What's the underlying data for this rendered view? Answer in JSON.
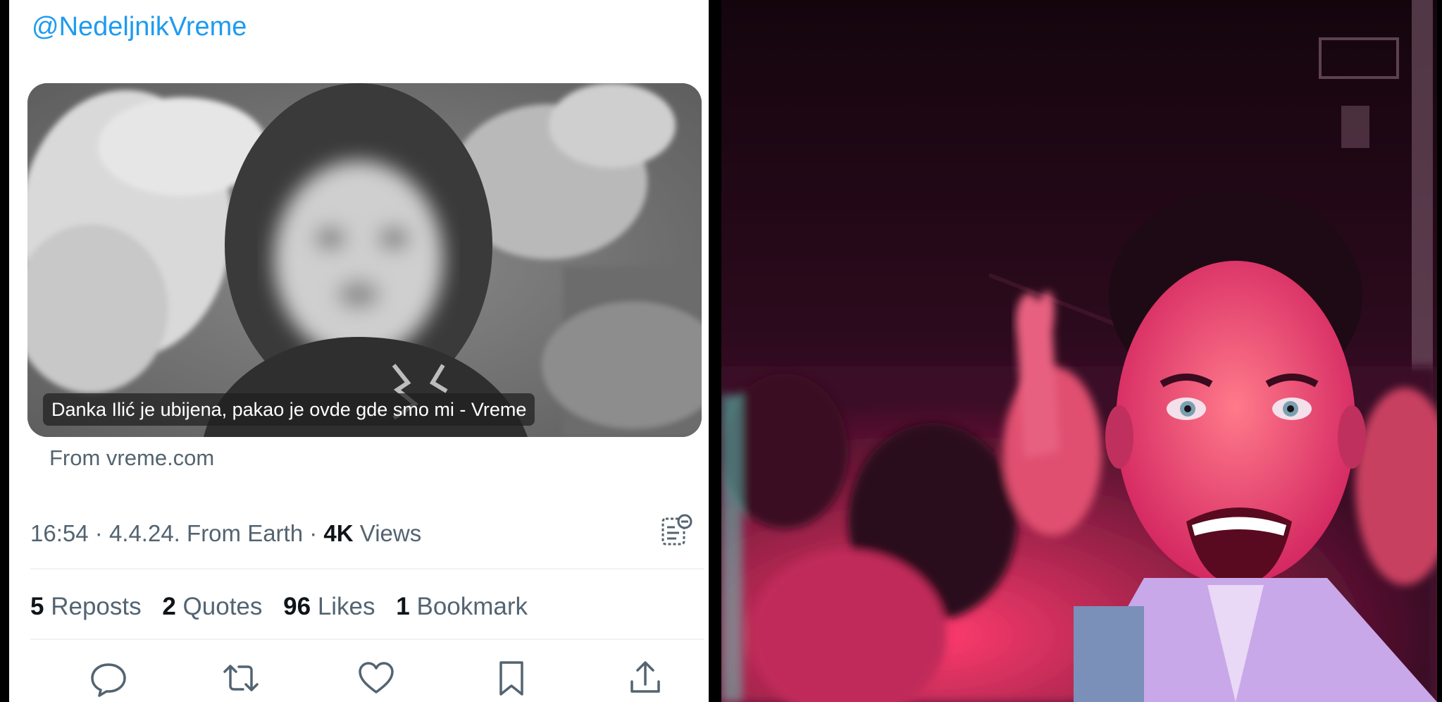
{
  "tweet": {
    "mention": "@NedeljnikVreme",
    "card": {
      "caption": "Danka Ilić je ubijena, pakao je ovde gde smo mi - Vreme",
      "source": "From vreme.com"
    },
    "meta": {
      "time": "16:54",
      "date": "4.4.24.",
      "location": "From Earth",
      "views_count": "4K",
      "views_label": "Views"
    },
    "stats": [
      {
        "count": "5",
        "label": "Reposts"
      },
      {
        "count": "2",
        "label": "Quotes"
      },
      {
        "count": "96",
        "label": "Likes"
      },
      {
        "count": "1",
        "label": "Bookmark"
      }
    ],
    "actions": [
      "reply-icon",
      "repost-icon",
      "like-icon",
      "bookmark-icon",
      "share-icon"
    ]
  },
  "colors": {
    "link": "#1d9bf0",
    "secondary_text": "#536471",
    "primary_text": "#0f1419",
    "divider": "#eff3f4"
  },
  "photo": {
    "description_icon": "selfie-photo"
  }
}
